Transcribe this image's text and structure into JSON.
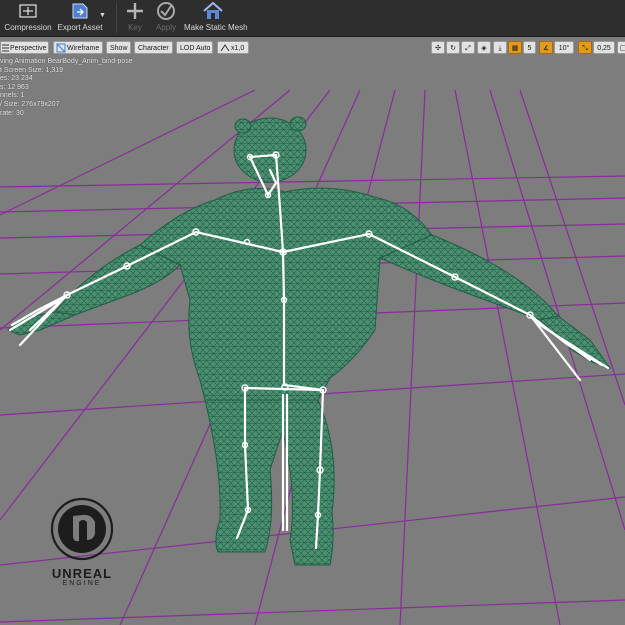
{
  "toolbar": {
    "compression": {
      "label": "Compression",
      "icon": "compression-icon"
    },
    "export_asset": {
      "label": "Export Asset",
      "icon": "export-icon"
    },
    "key": {
      "label": "Key",
      "icon": "plus-icon"
    },
    "apply": {
      "label": "Apply",
      "icon": "apply-icon"
    },
    "make_static_mesh": {
      "label": "Make Static Mesh",
      "icon": "house-icon"
    }
  },
  "viewport_toolbar": {
    "perspective": "Perspective",
    "wireframe": "Wireframe",
    "show": "Show",
    "character": "Character",
    "lod": "LOD Auto",
    "speed": "x1,0",
    "grid_snap": "5",
    "rotation_snap": "10°",
    "scale_snap": "0,25"
  },
  "info_overlay": [
    "ving Animation BearBody_Anim_bind-pose",
    "t Screen Size: 1,319",
    "es: 23 234",
    "s: 12 963",
    "nnels: 1",
    "/ Size: 276x79x207",
    "rate: 30"
  ],
  "logo": {
    "word": "UNREAL",
    "sub": "ENGINE"
  },
  "colors": {
    "viewport_bg": "#7d7d7d",
    "mesh_wire": "#2f7a5c",
    "mesh_fill": "#3f8e6c",
    "grid": "#8a2b9c",
    "bones": "#ffffff",
    "snap_active": "#e39a1d"
  }
}
